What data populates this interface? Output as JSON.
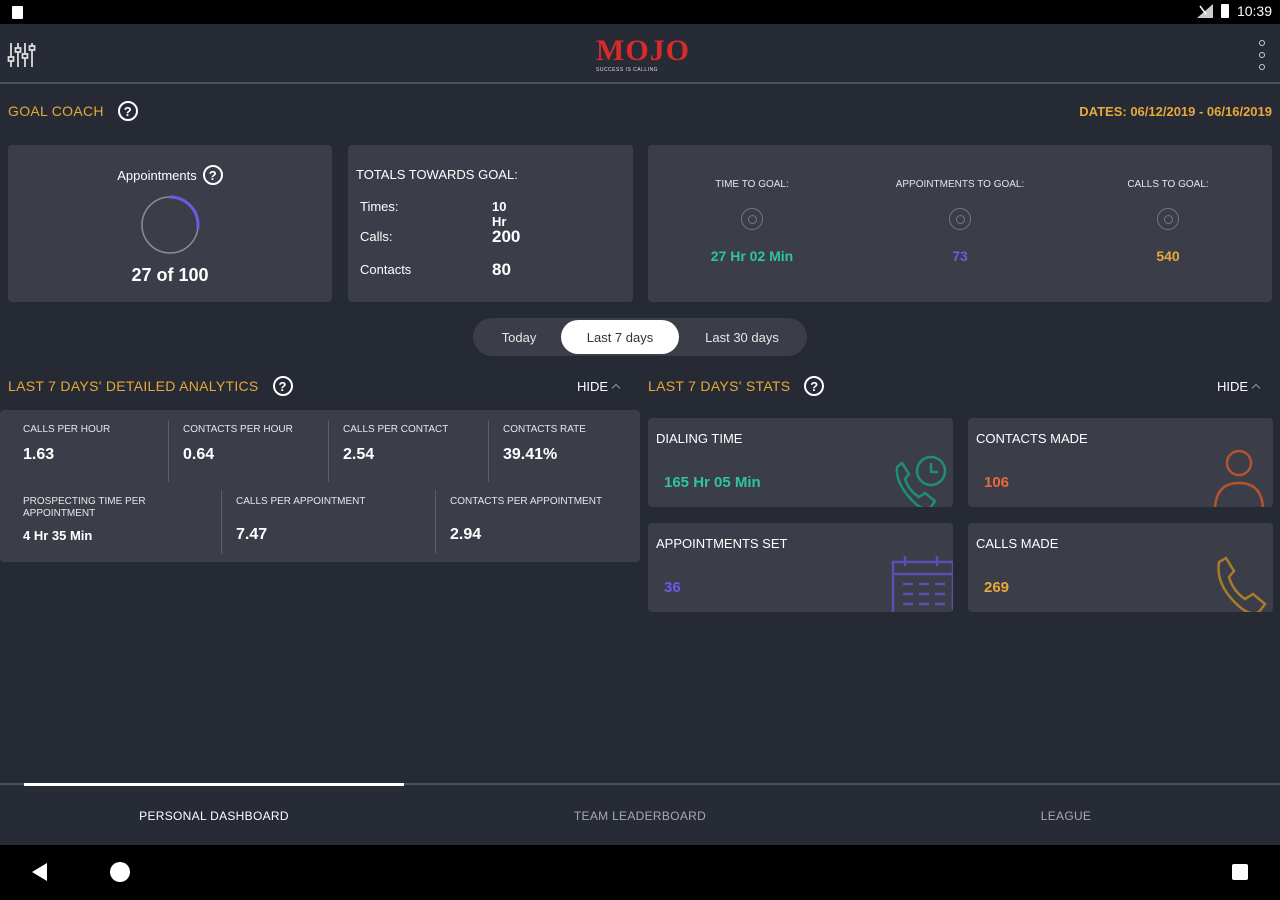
{
  "status_bar": {
    "time": "10:39"
  },
  "app": {
    "logo_text": "MOJO",
    "logo_tagline": "SUCCESS IS CALLING"
  },
  "goal_coach": {
    "title": "GOAL COACH",
    "dates": "DATES: 06/12/2019 - 06/16/2019"
  },
  "appointments_card": {
    "label": "Appointments",
    "count_text": "27 of 100",
    "progress": 0.27,
    "ring_color": "#6b5ce7"
  },
  "totals_card": {
    "title": "TOTALS TOWARDS GOAL:",
    "rows": [
      {
        "label": "Times:",
        "value": "10 Hr"
      },
      {
        "label": "Calls:",
        "value": "200"
      },
      {
        "label": "Contacts",
        "value": "80"
      }
    ]
  },
  "goals_card": {
    "items": [
      {
        "label": "TIME TO GOAL:",
        "value": "27 Hr 02 Min",
        "color": "#2ec4a0",
        "icon": "target-icon"
      },
      {
        "label": "APPOINTMENTS TO GOAL:",
        "value": "73",
        "color": "#6b5ce7",
        "icon": "target-icon"
      },
      {
        "label": "CALLS TO GOAL:",
        "value": "540",
        "color": "#e8a83a",
        "icon": "target-icon"
      }
    ]
  },
  "range_selector": {
    "options": [
      "Today",
      "Last 7 days",
      "Last 30 days"
    ],
    "selected": "Last 7 days"
  },
  "analytics": {
    "title": "LAST 7 DAYS' DETAILED ANALYTICS",
    "hide_label": "HIDE",
    "row1": [
      {
        "label": "CALLS PER HOUR",
        "value": "1.63"
      },
      {
        "label": "CONTACTS PER HOUR",
        "value": "0.64"
      },
      {
        "label": "CALLS PER CONTACT",
        "value": "2.54"
      },
      {
        "label": "CONTACTS RATE",
        "value": "39.41%"
      }
    ],
    "row2": [
      {
        "label": "PROSPECTING TIME PER APPOINTMENT",
        "value": "4 Hr 35 Min"
      },
      {
        "label": "CALLS PER APPOINTMENT",
        "value": "7.47"
      },
      {
        "label": "CONTACTS PER APPOINTMENT",
        "value": "2.94"
      }
    ]
  },
  "stats": {
    "title": "LAST 7 DAYS' STATS",
    "hide_label": "HIDE",
    "items": [
      {
        "label": "DIALING TIME",
        "value": "165 Hr 05 Min",
        "color": "#2ec4a0",
        "icon": "phone-clock-icon"
      },
      {
        "label": "CONTACTS MADE",
        "value": "106",
        "color": "#e8683a",
        "icon": "person-icon"
      },
      {
        "label": "APPOINTMENTS SET",
        "value": "36",
        "color": "#6b5ce7",
        "icon": "calendar-icon"
      },
      {
        "label": "CALLS MADE",
        "value": "269",
        "color": "#e8a83a",
        "icon": "phone-icon"
      }
    ]
  },
  "bottom_tabs": [
    "PERSONAL DASHBOARD",
    "TEAM LEADERBOARD",
    "LEAGUE"
  ]
}
